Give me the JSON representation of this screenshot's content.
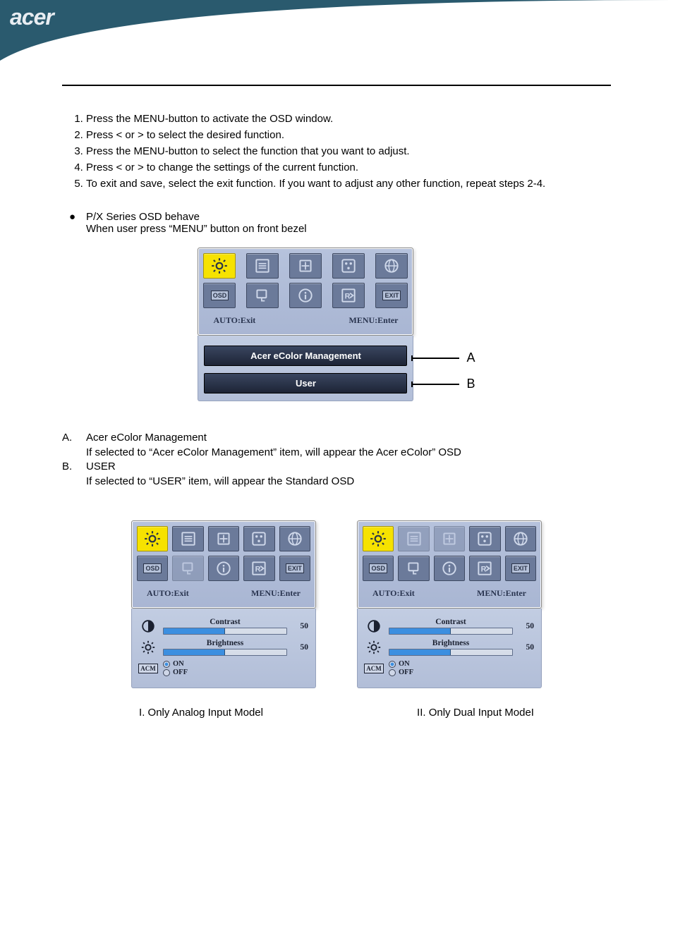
{
  "brand": "acer",
  "steps": [
    "Press the MENU-button to activate the OSD window.",
    "Press < or > to select the desired function.",
    "Press the MENU-button to select the function that you want to adjust.",
    "Press < or > to change the settings of the current function.",
    "To exit and save, select the exit function. If you want to adjust any other function, repeat steps 2-4."
  ],
  "behave": {
    "title": "P/X Series OSD behave",
    "sub": "When user press “MENU” button on front bezel"
  },
  "hints": {
    "left": "AUTO:Exit",
    "right": "MENU:Enter"
  },
  "banners": {
    "a": "Acer eColor Management",
    "b": "User"
  },
  "leads": {
    "a": "A",
    "b": "B"
  },
  "sublist": {
    "a_label": "A.",
    "a_title": "Acer eColor Management",
    "a_desc": "If selected to “Acer eColor Management” item, will appear the Acer eColor” OSD",
    "b_label": "B.",
    "b_title": "USER",
    "b_desc": "If selected to “USER” item, will appear the Standard OSD"
  },
  "params": {
    "contrast_label": "Contrast",
    "contrast_value": "50",
    "brightness_label": "Brightness",
    "brightness_value": "50",
    "on": "ON",
    "off": "OFF",
    "acm": "ACM"
  },
  "captions": {
    "left": "I. Only Analog Input Model",
    "right": "II. Only Dual Input ModeI"
  }
}
